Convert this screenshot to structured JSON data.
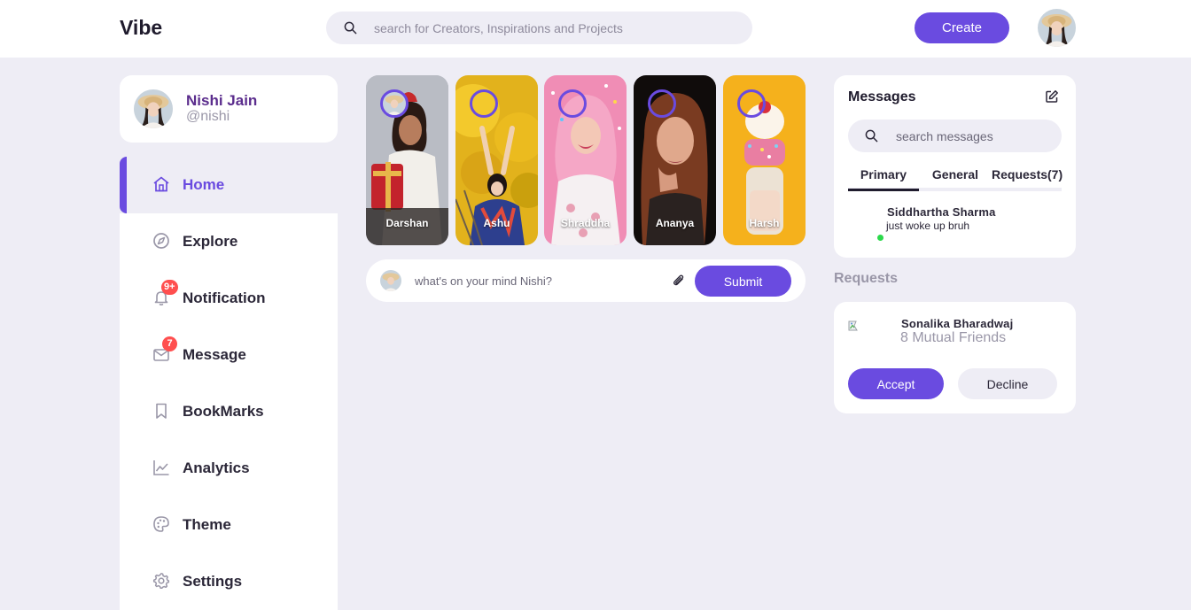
{
  "app": {
    "logo": "Vibe"
  },
  "header": {
    "search_placeholder": "search for Creators, Inspirations and Projects",
    "create_label": "Create"
  },
  "profile": {
    "name": "Nishi Jain",
    "handle": "@nishi"
  },
  "sidebar": {
    "items": [
      {
        "label": "Home",
        "icon": "home-icon",
        "active": true
      },
      {
        "label": "Explore",
        "icon": "compass-icon"
      },
      {
        "label": "Notification",
        "icon": "bell-icon",
        "badge": "9+"
      },
      {
        "label": "Message",
        "icon": "envelope-icon",
        "badge": "7"
      },
      {
        "label": "BookMarks",
        "icon": "bookmark-icon"
      },
      {
        "label": "Analytics",
        "icon": "chart-line-icon"
      },
      {
        "label": "Theme",
        "icon": "palette-icon"
      },
      {
        "label": "Settings",
        "icon": "gear-icon"
      }
    ]
  },
  "stories": [
    {
      "name": "Darshan"
    },
    {
      "name": "Ashu"
    },
    {
      "name": "Shraddha"
    },
    {
      "name": "Ananya"
    },
    {
      "name": "Harsh"
    }
  ],
  "post": {
    "placeholder": "what's on your mind Nishi?",
    "submit_label": "Submit"
  },
  "messages": {
    "title": "Messages",
    "search_placeholder": "search messages",
    "tabs": [
      "Primary",
      "General",
      "Requests(7)"
    ],
    "active_tab": "Primary",
    "items": [
      {
        "name": "Siddhartha Sharma",
        "text": "just woke up bruh",
        "online": true
      }
    ]
  },
  "requests": {
    "heading": "Requests",
    "items": [
      {
        "name": "Sonalika Bharadwaj",
        "mutual": "8 Mutual Friends",
        "accept_label": "Accept",
        "decline_label": "Decline"
      }
    ]
  },
  "colors": {
    "accent": "#6a4be0",
    "background": "#eeedf5",
    "badge": "#ff4f4f",
    "online": "#2bd94b"
  }
}
